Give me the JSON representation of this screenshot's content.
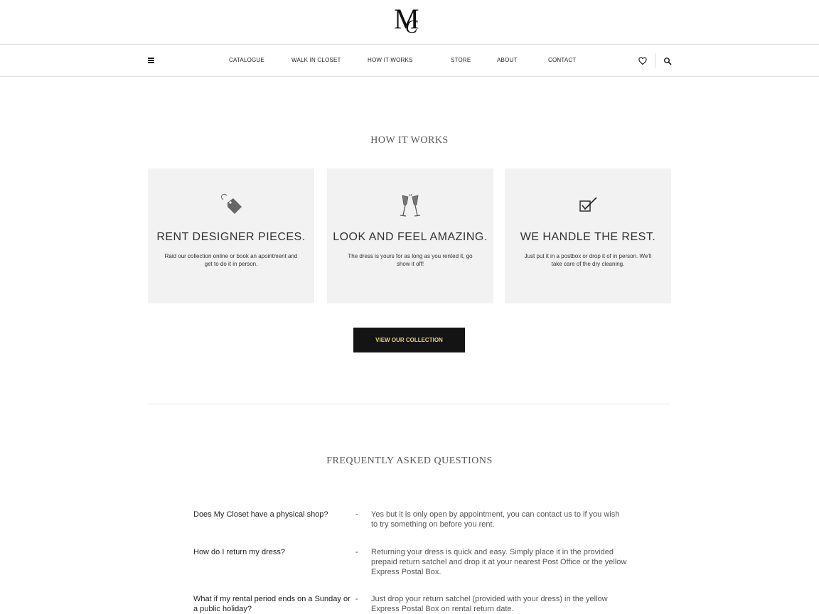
{
  "logo": {
    "letter_main": "M",
    "letter_sub": "C"
  },
  "nav": {
    "links": [
      "CATALOGUE",
      "WALK IN CLOSET",
      "HOW IT WORKS",
      "STORE",
      "ABOUT",
      "CONTACT"
    ],
    "icons": [
      "menu-icon",
      "heart-icon",
      "search-icon"
    ]
  },
  "how_it_works": {
    "title": "HOW IT WORKS",
    "cards": [
      {
        "icon": "price-tag-icon",
        "title": "RENT DESIGNER PIECES.",
        "text": "Raid our collection online or book an apointment and get to do it in person."
      },
      {
        "icon": "champagne-glasses-icon",
        "title": "LOOK AND FEEL AMAZING.",
        "text": "The dress is yours for as long as you rented it, go show it off!"
      },
      {
        "icon": "checkbox-icon",
        "title": "WE HANDLE THE REST.",
        "text": "Just put it in a postbox or drop it of in person. We'll take care of the dry cleaning."
      }
    ],
    "cta": "VIEW OUR COLLECTION"
  },
  "faq": {
    "title": "FREQUENTLY ASKED QUESTIONS",
    "dash": "-",
    "items": [
      {
        "q": "Does My Closet have a physical shop?",
        "a": "Yes but it is only open by appointment, you can contact us to if you wish to try something on before you rent."
      },
      {
        "q": "How do I return my dress?",
        "a": "Returning your dress is quick and easy. Simply place it in the provided prepaid return satchel and drop it at your nearest Post Office or the yellow Express Postal Box."
      },
      {
        "q": "What if my rental period ends on a Sunday or a public holiday?",
        "a": "Just drop your return satchel (provided with your dress) in the yellow Express Postal Box on rental return date."
      }
    ]
  },
  "colors": {
    "cta_bg": "#141414",
    "cta_text": "#e8cf7c",
    "card_bg": "#f2f2f2"
  }
}
